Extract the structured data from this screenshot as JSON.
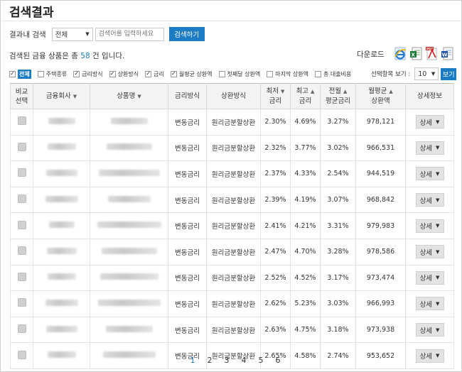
{
  "title": "검색결과",
  "search": {
    "label": "결과내 검색",
    "scope_value": "전체",
    "placeholder": "검색어를 입력하세요",
    "button": "검색하기"
  },
  "count": {
    "prefix": "검색된 금융 상품은 총 ",
    "number": "58",
    "suffix": " 건 입니다."
  },
  "download": {
    "label": "다운로드",
    "formats": [
      "ie-icon",
      "excel-icon",
      "pdf-icon",
      "word-icon"
    ]
  },
  "filters": [
    {
      "label": "전체",
      "checked": true,
      "badge": true
    },
    {
      "label": "주택종류",
      "checked": false
    },
    {
      "label": "금리방식",
      "checked": true
    },
    {
      "label": "상환방식",
      "checked": true
    },
    {
      "label": "금리",
      "checked": true
    },
    {
      "label": "월평균 상환액",
      "checked": true
    },
    {
      "label": "첫째달 상환액",
      "checked": false
    },
    {
      "label": "마지막 상환액",
      "checked": false
    },
    {
      "label": "총 대출비용",
      "checked": false
    }
  ],
  "perpage": {
    "label": "선택항목 보기 :",
    "value": "10",
    "button": "보기"
  },
  "table": {
    "headers": {
      "compare": [
        "비교",
        "선택"
      ],
      "company": "금융회사",
      "product": "상품명",
      "rate_type": "금리방식",
      "repay_type": "상환방식",
      "min_rate": [
        "최저",
        "금리"
      ],
      "max_rate": [
        "최고",
        "금리"
      ],
      "prev_rate": [
        "전월",
        "평균금리"
      ],
      "monthly": [
        "월평균",
        "상환액"
      ],
      "detail": "상세정보"
    },
    "rows": [
      {
        "rate_type": "변동금리",
        "repay_type": "원리금분할상환",
        "min": "2.30%",
        "max": "4.69%",
        "prev": "3.27%",
        "monthly": "978,121",
        "detail": "상세"
      },
      {
        "rate_type": "변동금리",
        "repay_type": "원리금분할상환",
        "min": "2.32%",
        "max": "3.77%",
        "prev": "3.02%",
        "monthly": "966,531",
        "detail": "상세"
      },
      {
        "rate_type": "변동금리",
        "repay_type": "원리금분할상환",
        "min": "2.37%",
        "max": "4.33%",
        "prev": "2.54%",
        "monthly": "944,519",
        "detail": "상세"
      },
      {
        "rate_type": "변동금리",
        "repay_type": "원리금분할상환",
        "min": "2.39%",
        "max": "4.19%",
        "prev": "3.07%",
        "monthly": "968,842",
        "detail": "상세"
      },
      {
        "rate_type": "변동금리",
        "repay_type": "원리금분할상환",
        "min": "2.41%",
        "max": "4.21%",
        "prev": "3.31%",
        "monthly": "979,983",
        "detail": "상세"
      },
      {
        "rate_type": "변동금리",
        "repay_type": "원리금분할상환",
        "min": "2.47%",
        "max": "4.70%",
        "prev": "3.28%",
        "monthly": "978,586",
        "detail": "상세"
      },
      {
        "rate_type": "변동금리",
        "repay_type": "원리금분할상환",
        "min": "2.52%",
        "max": "4.52%",
        "prev": "3.17%",
        "monthly": "973,474",
        "detail": "상세"
      },
      {
        "rate_type": "변동금리",
        "repay_type": "원리금분할상환",
        "min": "2.62%",
        "max": "5.23%",
        "prev": "3.03%",
        "monthly": "966,993",
        "detail": "상세"
      },
      {
        "rate_type": "변동금리",
        "repay_type": "원리금분할상환",
        "min": "2.63%",
        "max": "4.75%",
        "prev": "3.18%",
        "monthly": "973,938",
        "detail": "상세"
      },
      {
        "rate_type": "변동금리",
        "repay_type": "원리금분할상환",
        "min": "2.65%",
        "max": "4.58%",
        "prev": "2.74%",
        "monthly": "953,652",
        "detail": "상세"
      }
    ]
  },
  "pagination": {
    "pages": [
      "1",
      "2",
      "3",
      "4",
      "5",
      "6"
    ],
    "current": "1"
  },
  "colors": {
    "accent": "#1b7cc4",
    "header_bg": "#f3f3f3"
  }
}
